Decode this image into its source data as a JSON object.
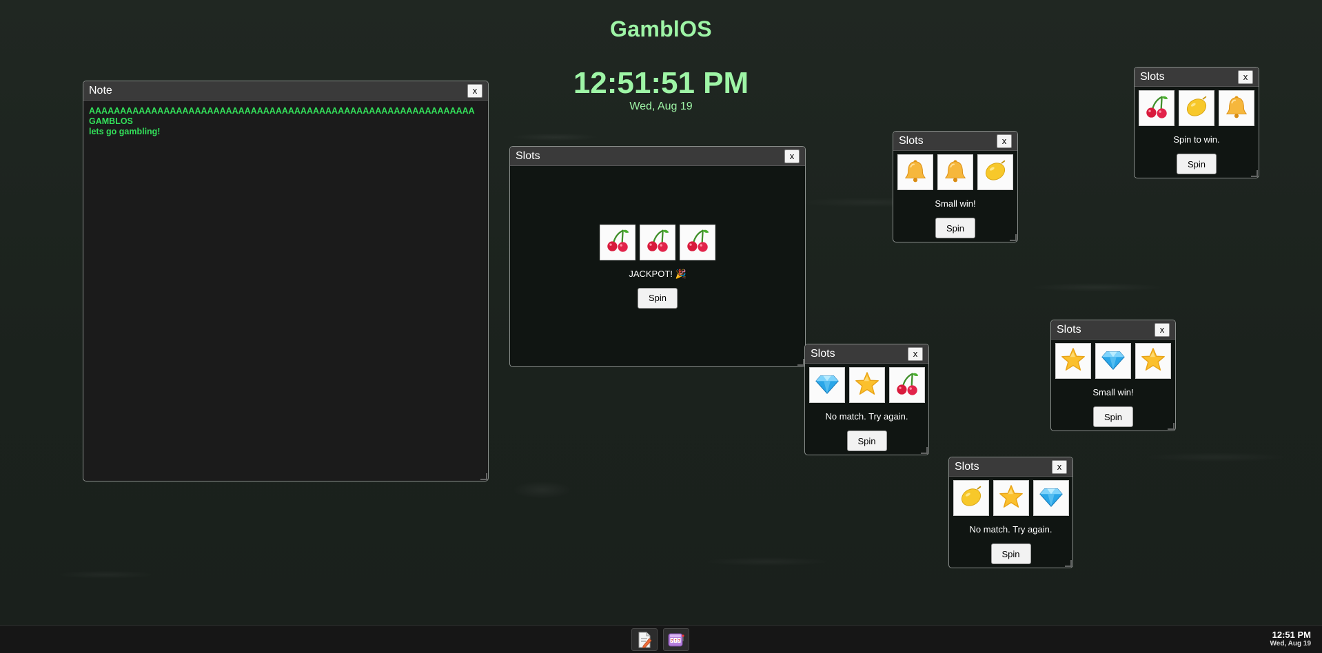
{
  "desktop": {
    "brand": "GamblOS",
    "clock_time": "12:51:51 PM",
    "clock_date": "Wed, Aug 19"
  },
  "note": {
    "title": "Note",
    "close_label": "x",
    "content": "AAAAAAAAAAAAAAAAAAAAAAAAAAAAAAAAAAAAAAAAAAAAAAAAAAAAAAAAAAAAAA\nGAMBLOS\nlets go gambling!"
  },
  "slots": [
    {
      "title": "Slots",
      "close_label": "x",
      "reels": [
        "cherry",
        "cherry",
        "cherry"
      ],
      "message": "JACKPOT! 🎉",
      "spin_label": "Spin"
    },
    {
      "title": "Slots",
      "close_label": "x",
      "reels": [
        "bell",
        "bell",
        "lemon"
      ],
      "message": "Small win!",
      "spin_label": "Spin"
    },
    {
      "title": "Slots",
      "close_label": "x",
      "reels": [
        "cherry",
        "lemon",
        "bell"
      ],
      "message": "Spin to win.",
      "spin_label": "Spin"
    },
    {
      "title": "Slots",
      "close_label": "x",
      "reels": [
        "diamond",
        "star",
        "cherry"
      ],
      "message": "No match. Try again.",
      "spin_label": "Spin"
    },
    {
      "title": "Slots",
      "close_label": "x",
      "reels": [
        "star",
        "diamond",
        "star"
      ],
      "message": "Small win!",
      "spin_label": "Spin"
    },
    {
      "title": "Slots",
      "close_label": "x",
      "reels": [
        "lemon",
        "star",
        "diamond"
      ],
      "message": "No match. Try again.",
      "spin_label": "Spin"
    }
  ],
  "taskbar": {
    "apps": [
      "note-app-icon",
      "slots-app-icon"
    ],
    "time": "12:51 PM",
    "date": "Wed, Aug 19"
  }
}
